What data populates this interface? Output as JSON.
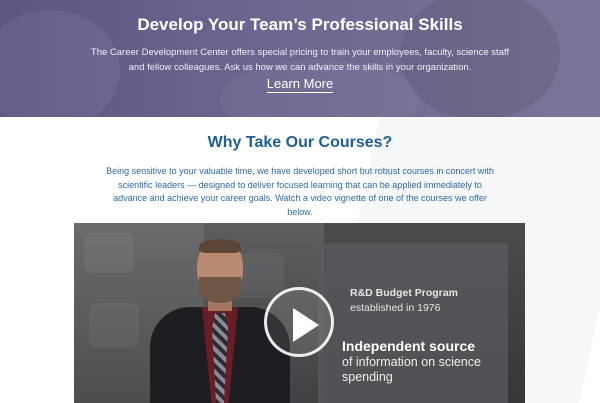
{
  "hero": {
    "title": "Develop Your Team’s Professional Skills",
    "description": "The Career Development Center offers special pricing to train your employees, faculty, science staff and fellow colleagues. Ask us how we can advance the skills in your organization.",
    "link_label": "Learn More"
  },
  "section": {
    "title": "Why Take Our Courses?",
    "description": "Being sensitive to your valuable time, we have developed short but robust courses in concert with scientific leaders — designed to deliver focused learning that can be applied immediately to advance and achieve your career goals. Watch a video vignette of one of the courses we offer below."
  },
  "video": {
    "overlay_heading": "R&D Budget Program",
    "overlay_subheading": "established in 1976",
    "overlay_big": "Independent source",
    "overlay_small": "of information on science spending",
    "play_icon": "play-icon"
  },
  "colors": {
    "hero_bg": "#6c6790",
    "section_title": "#1f5f99",
    "section_text": "#2d6aa3"
  }
}
